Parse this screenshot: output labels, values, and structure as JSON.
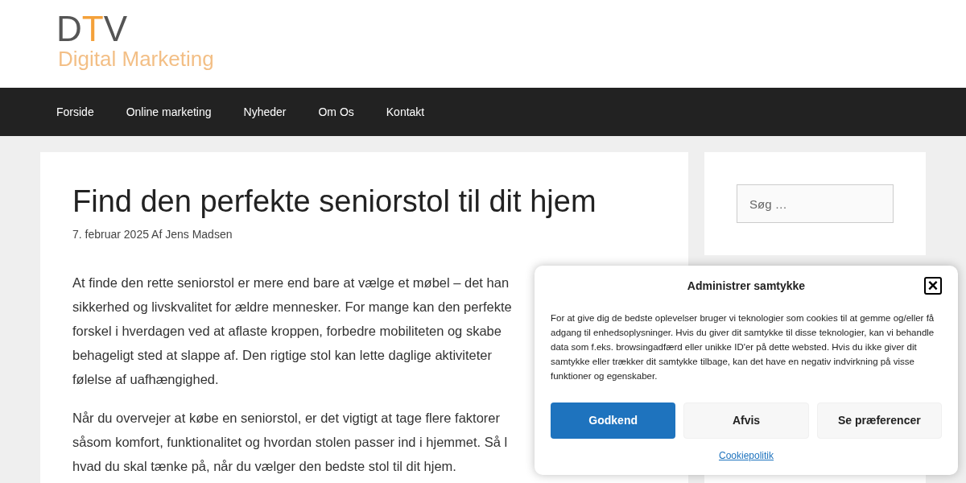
{
  "logo": {
    "letters": [
      {
        "text": "D",
        "color": "#555555"
      },
      {
        "text": "T",
        "color": "#f4a13a"
      },
      {
        "text": "V",
        "color": "#555555"
      }
    ],
    "tagline": "Digital Marketing"
  },
  "nav": [
    {
      "label": "Forside"
    },
    {
      "label": "Online marketing"
    },
    {
      "label": "Nyheder"
    },
    {
      "label": "Om Os"
    },
    {
      "label": "Kontakt"
    }
  ],
  "article": {
    "title": "Find den perfekte seniorstol til dit hjem",
    "meta": "7. februar 2025 Af Jens Madsen",
    "paragraphs": [
      [
        "At finde den rette seniorstol er mere end bare at vælge et møbel – det han",
        "sikkerhed og livskvalitet for ældre mennesker. For mange kan den perfekte",
        "forskel i hverdagen ved at aflaste kroppen, forbedre mobiliteten og skabe",
        "behageligt sted at slappe af. Den rigtige stol kan lette daglige aktiviteter",
        "følelse af uafhængighed."
      ],
      [
        "Når du overvejer at købe en seniorstol, er det vigtigt at tage flere faktorer",
        "såsom komfort, funktionalitet og hvordan stolen passer ind i hjemmet. Så l",
        "hvad du skal tænke på, når du vælger den bedste stol til dit hjem."
      ]
    ]
  },
  "sidebar": {
    "search": {
      "placeholder": "Søg …"
    }
  },
  "consent": {
    "title": "Administrer samtykke",
    "close": "×",
    "text": "For at give dig de bedste oplevelser bruger vi teknologier som cookies til at gemme og/eller få adgang til enhedsoplysninger. Hvis du giver dit samtykke til disse teknologier, kan vi behandle data som f.eks. browsingadfærd eller unikke ID'er på dette websted. Hvis du ikke giver dit samtykke eller trækker dit samtykke tilbage, kan det have en negativ indvirkning på visse funktioner og egenskaber.",
    "buttons": [
      {
        "label": "Godkend",
        "kind": "primary"
      },
      {
        "label": "Afvis",
        "kind": "secondary"
      },
      {
        "label": "Se præferencer",
        "kind": "secondary"
      }
    ],
    "link": "Cookiepolitik"
  }
}
